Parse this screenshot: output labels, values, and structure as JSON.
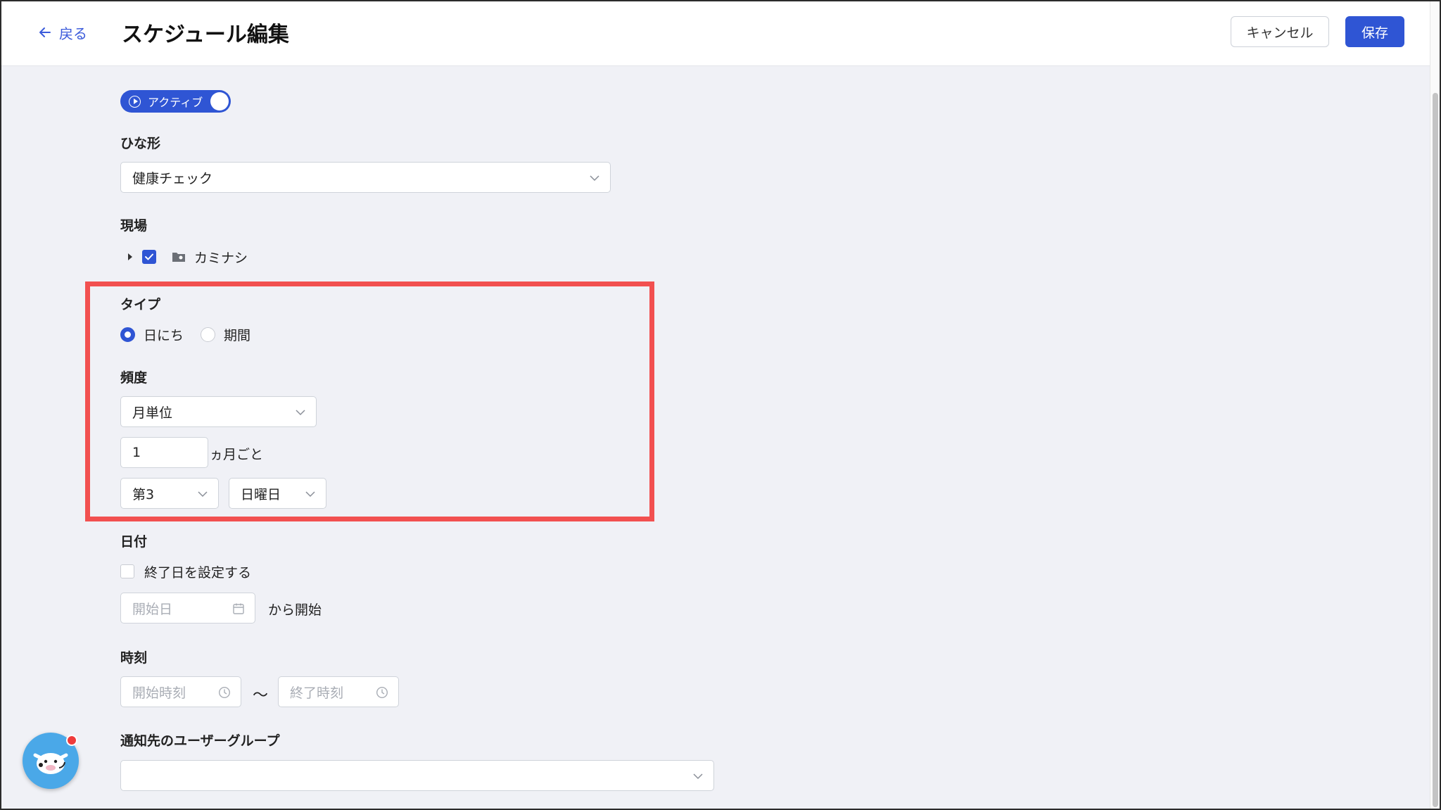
{
  "header": {
    "back_label": "戻る",
    "title": "スケジュール編集",
    "cancel_label": "キャンセル",
    "save_label": "保存"
  },
  "status_toggle": {
    "label": "アクティブ",
    "on": true
  },
  "template": {
    "label": "ひな形",
    "value": "健康チェック"
  },
  "site": {
    "label": "現場",
    "item": "カミナシ",
    "checked": true
  },
  "type": {
    "label": "タイプ",
    "options": [
      "日にち",
      "期間"
    ],
    "selected": "日にち"
  },
  "frequency": {
    "label": "頻度",
    "unit_value": "月単位",
    "interval_value": "1",
    "interval_suffix": "ヵ月ごと",
    "week_value": "第3",
    "day_value": "日曜日"
  },
  "date": {
    "label": "日付",
    "end_date_checkbox_label": "終了日を設定する",
    "end_date_checked": false,
    "start_placeholder": "開始日",
    "start_suffix": "から開始"
  },
  "time": {
    "label": "時刻",
    "start_placeholder": "開始時刻",
    "separator": "〜",
    "end_placeholder": "終了時刻"
  },
  "notify": {
    "label": "通知先のユーザーグループ",
    "value": ""
  },
  "colors": {
    "accent": "#2f55d4",
    "highlight": "#f25050",
    "background": "#f0f1f6"
  }
}
